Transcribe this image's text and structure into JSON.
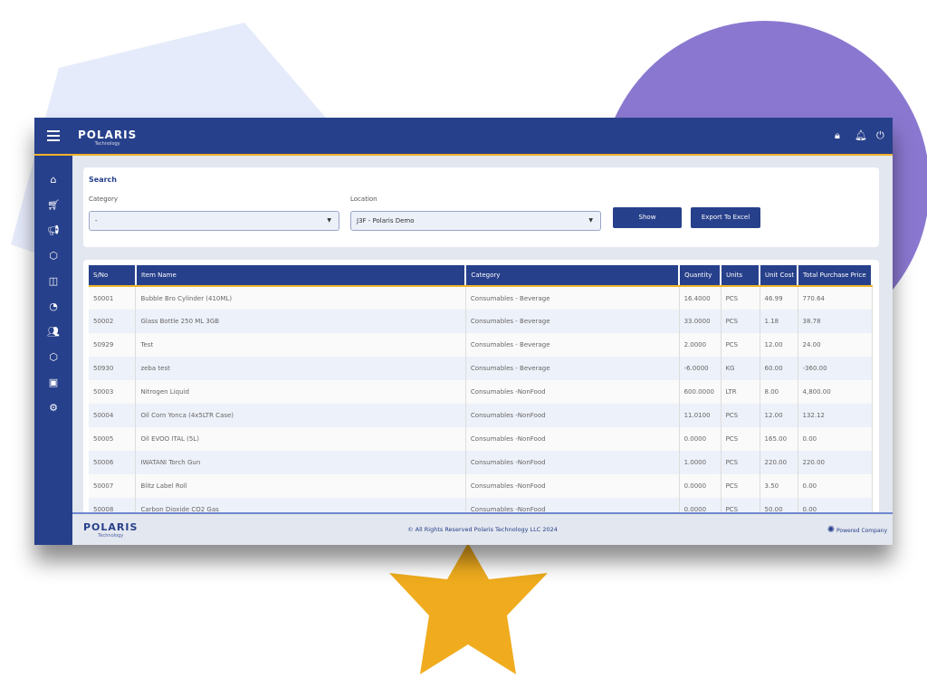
{
  "header": {
    "logo": "POLARIS",
    "logo_sub": "Technology"
  },
  "search": {
    "title": "Search",
    "category_label": "Category",
    "category_value": "-",
    "location_label": "Location",
    "location_value": "J3F - Polaris Demo",
    "show_label": "Show",
    "export_label": "Export To Excel"
  },
  "table": {
    "columns": [
      "S/No",
      "Item Name",
      "Category",
      "Quantity",
      "Units",
      "Unit Cost",
      "Total Purchase Price"
    ],
    "rows": [
      [
        "50001",
        "Bubble Bro Cylinder (410ML)",
        "Consumables - Beverage",
        "16.4000",
        "PCS",
        "46.99",
        "770.64"
      ],
      [
        "50002",
        "Glass Bottle 250 ML 3GB",
        "Consumables - Beverage",
        "33.0000",
        "PCS",
        "1.18",
        "38.78"
      ],
      [
        "50929",
        "Test",
        "Consumables - Beverage",
        "2.0000",
        "PCS",
        "12.00",
        "24.00"
      ],
      [
        "50930",
        "zeba test",
        "Consumables - Beverage",
        "-6.0000",
        "KG",
        "60.00",
        "-360.00"
      ],
      [
        "50003",
        "Nitrogen Liquid",
        "Consumables -NonFood",
        "600.0000",
        "LTR",
        "8.00",
        "4,800.00"
      ],
      [
        "50004",
        "Oil Corn Yonca (4x5LTR Case)",
        "Consumables -NonFood",
        "11.0100",
        "PCS",
        "12.00",
        "132.12"
      ],
      [
        "50005",
        "Oil EVOO ITAL (5L)",
        "Consumables -NonFood",
        "0.0000",
        "PCS",
        "165.00",
        "0.00"
      ],
      [
        "50006",
        "IWATANI Torch Gun",
        "Consumables -NonFood",
        "1.0000",
        "PCS",
        "220.00",
        "220.00"
      ],
      [
        "50007",
        "Blitz Label Roll",
        "Consumables -NonFood",
        "0.0000",
        "PCS",
        "3.50",
        "0.00"
      ],
      [
        "50008",
        "Carbon Dioxide CO2 Gas",
        "Consumables -NonFood",
        "0.0000",
        "PCS",
        "50.00",
        "0.00"
      ]
    ]
  },
  "footer": {
    "copyright": "© All Rights Reserved Polaris Technology LLC 2024",
    "powered": "Powered Company"
  },
  "colors": {
    "primary": "#27408b",
    "accent": "#f0b429",
    "decor_purple": "#8a78d0"
  }
}
